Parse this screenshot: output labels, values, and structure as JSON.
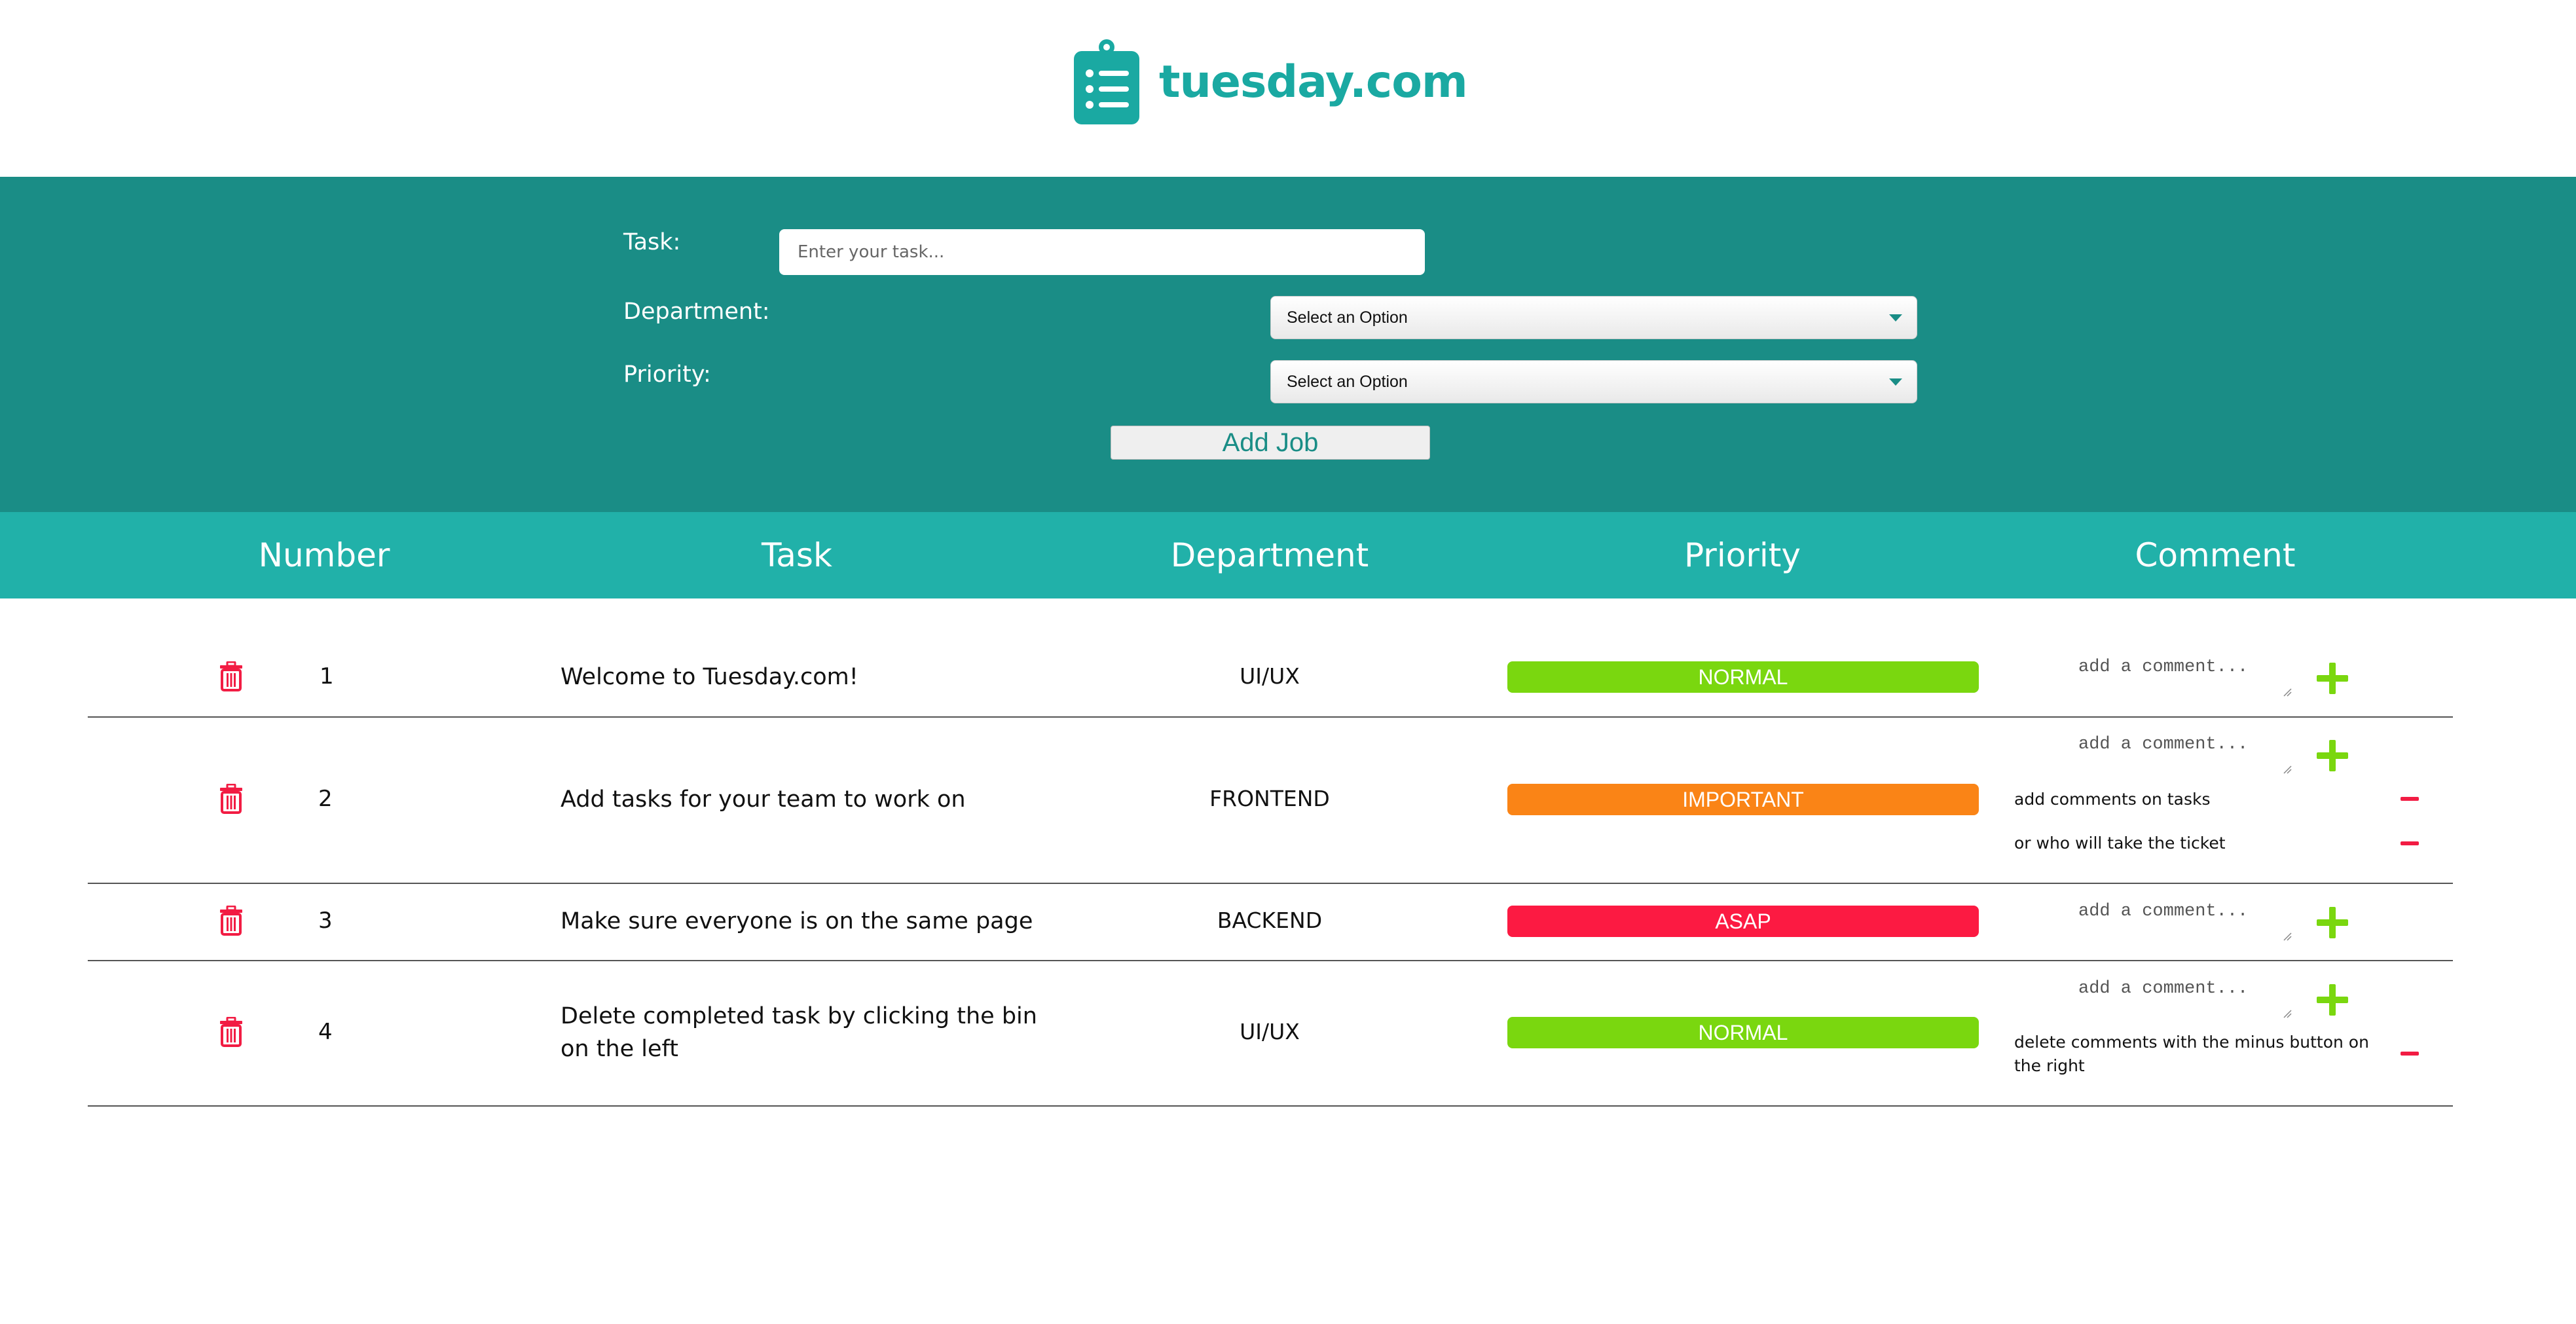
{
  "brand": {
    "name": "tuesday.com",
    "icon": "clipboard-list-icon",
    "color": "#1aa9a2"
  },
  "form": {
    "task_label": "Task:",
    "task_placeholder": "Enter your task...",
    "department_label": "Department:",
    "department_value": "Select an Option",
    "priority_label": "Priority:",
    "priority_value": "Select an Option",
    "add_button": "Add Job"
  },
  "table": {
    "headers": [
      "Number",
      "Task",
      "Department",
      "Priority",
      "Comment"
    ],
    "comment_placeholder": "add a comment...",
    "rows": [
      {
        "number": "1",
        "task": "Welcome to Tuesday.com!",
        "department": "UI/UX",
        "priority": "NORMAL",
        "priority_color": "#7ad70f",
        "comments": []
      },
      {
        "number": "2",
        "task": "Add tasks for your team to work on",
        "department": "FRONTEND",
        "priority": "IMPORTANT",
        "priority_color": "#fa8416",
        "comments": [
          "add comments on tasks",
          "or who will take the ticket"
        ]
      },
      {
        "number": "3",
        "task": "Make sure everyone is on the same page",
        "department": "BACKEND",
        "priority": "ASAP",
        "priority_color": "#fc1a42",
        "comments": []
      },
      {
        "number": "4",
        "task": "Delete completed task by clicking the bin on the left",
        "department": "UI/UX",
        "priority": "NORMAL",
        "priority_color": "#7ad70f",
        "comments": [
          "delete comments with the minus button on the right"
        ]
      }
    ]
  },
  "colors": {
    "form_band": "#1a8d86",
    "table_header": "#21b1a9",
    "trash": "#f21c43",
    "plus": "#7ad70f",
    "minus": "#f21c43"
  }
}
